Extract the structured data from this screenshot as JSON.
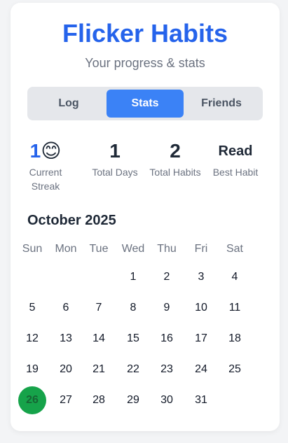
{
  "header": {
    "title": "Flicker Habits",
    "subtitle": "Your progress & stats"
  },
  "tabs": [
    {
      "label": "Log",
      "active": false
    },
    {
      "label": "Stats",
      "active": true
    },
    {
      "label": "Friends",
      "active": false
    }
  ],
  "stats": {
    "streak": {
      "value": "1",
      "emoji": "😊",
      "label": "Current Streak"
    },
    "total_days": {
      "value": "1",
      "label": "Total Days"
    },
    "total_habits": {
      "value": "2",
      "label": "Total Habits"
    },
    "best_habit": {
      "value": "Read",
      "label": "Best Habit"
    }
  },
  "calendar": {
    "month": "October 2025",
    "weekdays": [
      "Sun",
      "Mon",
      "Tue",
      "Wed",
      "Thu",
      "Fri",
      "Sat"
    ],
    "first_weekday": 3,
    "days_in_month": 31,
    "highlight_day": 26,
    "highlight_color": "#16a34a"
  },
  "colors": {
    "accent": "#2563eb",
    "active_tab": "#3b82f6",
    "success": "#16a34a"
  }
}
